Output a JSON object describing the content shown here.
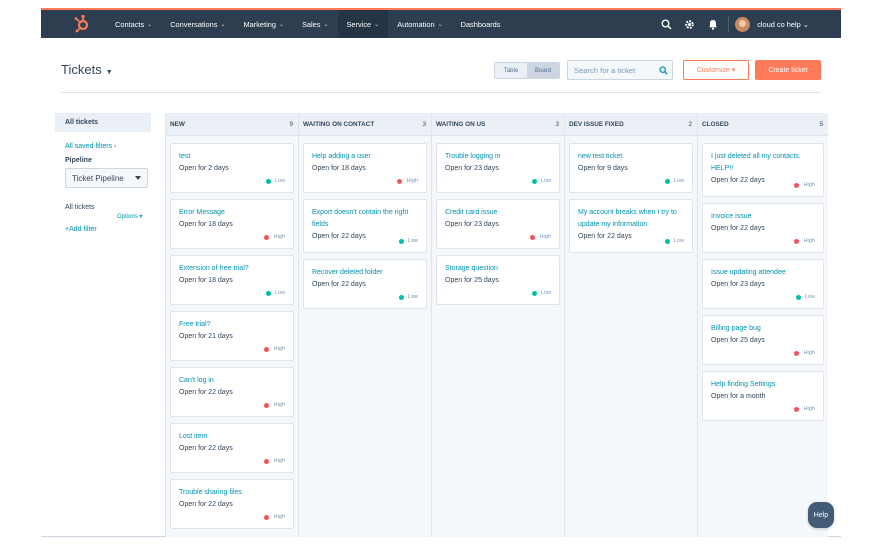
{
  "colors": {
    "accent": "#ff7a59",
    "nav_bg": "#2d3e50",
    "link": "#0091ae",
    "low": "#00bda5",
    "high": "#f2545b"
  },
  "nav": {
    "logo_icon": "sprocket-icon",
    "items": [
      {
        "label": "Contacts",
        "has_caret": true
      },
      {
        "label": "Conversations",
        "has_caret": true
      },
      {
        "label": "Marketing",
        "has_caret": true
      },
      {
        "label": "Sales",
        "has_caret": true
      },
      {
        "label": "Service",
        "has_caret": true
      },
      {
        "label": "Automation",
        "has_caret": true
      },
      {
        "label": "Dashboards",
        "has_caret": false
      }
    ],
    "caret_glyph": "⌄",
    "account": "cloud co help ⌄"
  },
  "header": {
    "title": "Tickets",
    "view_table": "Table",
    "view_board": "Board",
    "search_placeholder": "Search for a ticket",
    "customize": "Customize ▾",
    "create": "Create ticket"
  },
  "sidebar": {
    "all_tickets": "All tickets",
    "saved_filters": "All saved filters ›",
    "pipeline_label": "Pipeline",
    "pipeline_value": "Ticket Pipeline",
    "filter_label": "All tickets",
    "options": "Options ▾",
    "add_filter": "+Add filter"
  },
  "board": {
    "columns": [
      {
        "name": "NEW",
        "count": "9",
        "cards": [
          {
            "title": "test",
            "age": "Open for 2 days",
            "priority": "Low"
          },
          {
            "title": "Error Message",
            "age": "Open for 18 days",
            "priority": "High"
          },
          {
            "title": "Extension of free trial?",
            "age": "Open for 18 days",
            "priority": "Low"
          },
          {
            "title": "Free trial?",
            "age": "Open for 21 days",
            "priority": "High"
          },
          {
            "title": "Can't log in",
            "age": "Open for 22 days",
            "priority": "High"
          },
          {
            "title": "Lost item",
            "age": "Open for 22 days",
            "priority": "High"
          },
          {
            "title": "Trouble sharing files",
            "age": "Open for 22 days",
            "priority": "High"
          }
        ]
      },
      {
        "name": "WAITING ON CONTACT",
        "count": "3",
        "cards": [
          {
            "title": "Help adding a user",
            "age": "Open for 18 days",
            "priority": "High"
          },
          {
            "title": "Export doesn't contain the right fields",
            "age": "Open for 22 days",
            "priority": "Low"
          },
          {
            "title": "Recover deleted folder",
            "age": "Open for 22 days",
            "priority": "Low"
          }
        ]
      },
      {
        "name": "WAITING ON US",
        "count": "3",
        "cards": [
          {
            "title": "Trouble logging in",
            "age": "Open for 23 days",
            "priority": "Low"
          },
          {
            "title": "Credit card issue",
            "age": "Open for 23 days",
            "priority": "High"
          },
          {
            "title": "Storage question",
            "age": "Open for 25 days",
            "priority": "Low"
          }
        ]
      },
      {
        "name": "DEV ISSUE FIXED",
        "count": "2",
        "cards": [
          {
            "title": "new test ticket",
            "age": "Open for 9 days",
            "priority": "Low"
          },
          {
            "title": "My account breaks when I try to update my information",
            "age": "Open for 22 days",
            "priority": "Low"
          }
        ]
      },
      {
        "name": "CLOSED",
        "count": "5",
        "cards": [
          {
            "title": "I just deleted all my contacts. HELP!!",
            "age": "Open for 22 days",
            "priority": "High"
          },
          {
            "title": "Invoice issue",
            "age": "Open for 22 days",
            "priority": "High"
          },
          {
            "title": "Issue updating attendee",
            "age": "Open for 23 days",
            "priority": "Low"
          },
          {
            "title": "Billing page bug",
            "age": "Open for 25 days",
            "priority": "High"
          },
          {
            "title": "Help finding Settings",
            "age": "Open for a month",
            "priority": "High"
          }
        ]
      }
    ]
  },
  "help": "Help"
}
